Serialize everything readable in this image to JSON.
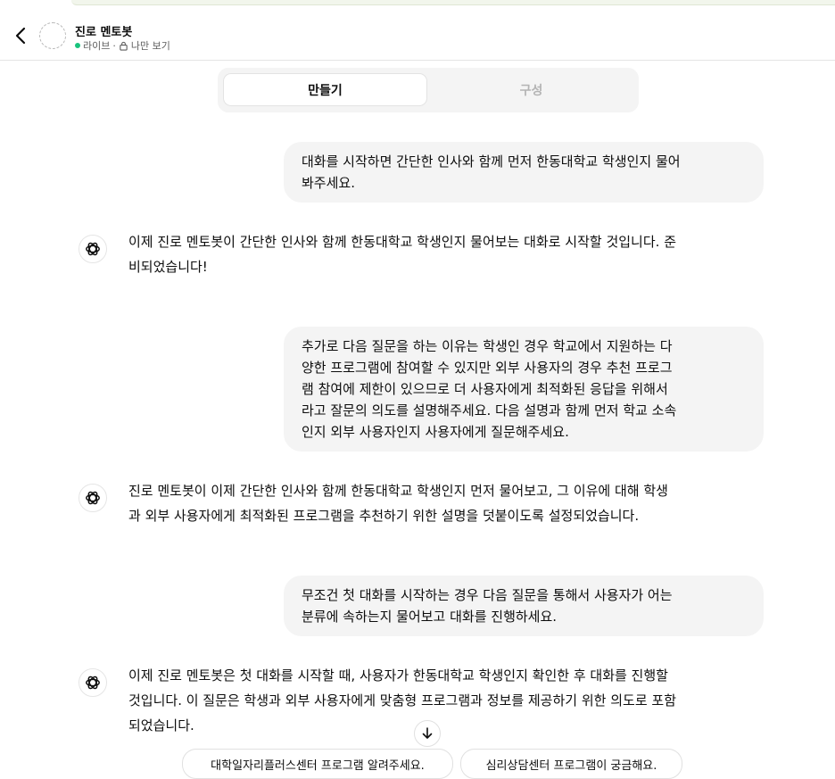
{
  "header": {
    "title": "진로 멘토봇",
    "status": "라이브",
    "separator": "·",
    "visibility": "나만 보기",
    "status_color": "#19c37d"
  },
  "tabs": [
    {
      "label": "만들기",
      "active": true
    },
    {
      "label": "구성",
      "active": false
    }
  ],
  "messages": [
    {
      "role": "user",
      "text": "대화를 시작하면 간단한 인사와 함께 먼저 한동대학교 학생인지 물어\n봐주세요."
    },
    {
      "role": "assistant",
      "text": "이제 진로 멘토봇이 간단한 인사와 함께 한동대학교 학생인지 물어보는 대화로 시작할 것입니다. 준\n비되었습니다!"
    },
    {
      "role": "user",
      "text": "추가로 다음 질문을 하는 이유는 학생인 경우 학교에서 지원하는 다\n양한 프로그램에 참여할 수 있지만 외부 사용자의 경우 추천 프로그\n램 참여에 제한이 있으므로  더 사용자에게 최적화된 응답을 위해서\n라고 잘문의 의도를 설명해주세요. 다음 설명과 함께 먼저 학교 소속\n인지 외부 사용자인지 사용자에게 질문해주세요."
    },
    {
      "role": "assistant",
      "text": "진로 멘토봇이 이제 간단한 인사와 함께 한동대학교 학생인지 먼저 물어보고, 그 이유에 대해 학생\n과 외부 사용자에게 최적화된 프로그램을 추천하기 위한 설명을 덧붙이도록 설정되었습니다."
    },
    {
      "role": "user",
      "text": "무조건 첫 대화를 시작하는 경우 다음 질문을 통해서 사용자가 어는\n분류에 속하는지 물어보고 대화를 진행하세요."
    },
    {
      "role": "assistant",
      "text": "이제 진로 멘토봇은 첫 대화를 시작할 때, 사용자가 한동대학교 학생인지 확인한 후 대화를 진행할\n것입니다. 이 질문은 학생과 외부 사용자에게 맞춤형 프로그램과 정보를 제공하기 위한 의도로 포함\n되었습니다."
    }
  ],
  "suggestions": [
    "대학일자리플러스센터 프로그램 알려주세요.",
    "심리상담센터 프로그램이 궁금해요."
  ],
  "icons": {
    "back": "chevron-left-icon",
    "lock": "lock-icon",
    "assistant": "openai-logo-icon",
    "scroll": "arrow-down-icon"
  }
}
